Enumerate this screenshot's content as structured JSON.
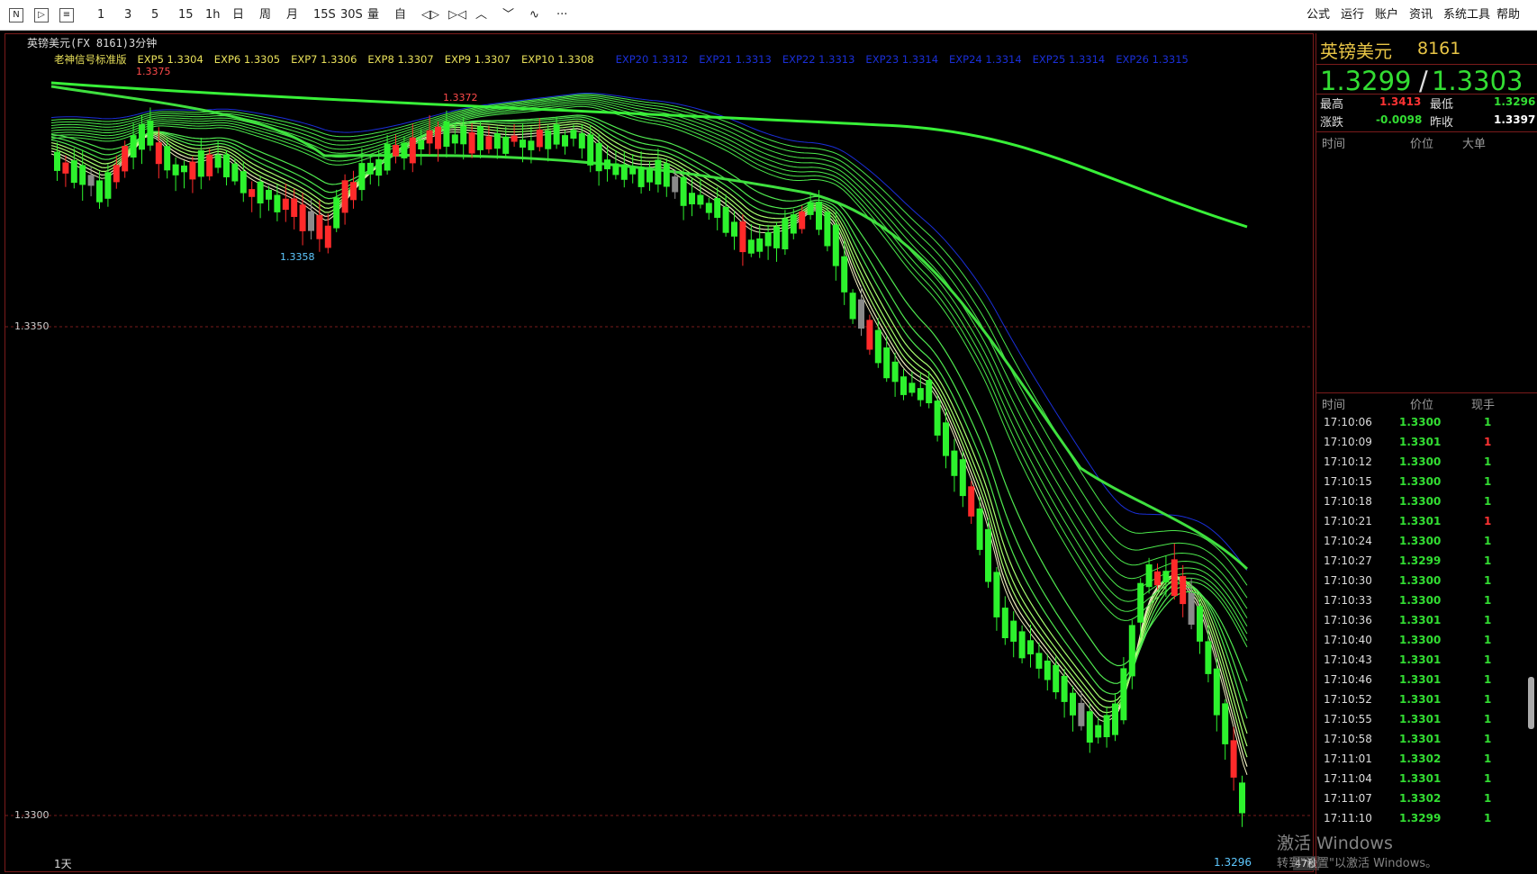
{
  "toolbar": {
    "boxed_buttons": [
      {
        "label": "N",
        "name": "new-button"
      },
      {
        "label": "▷",
        "name": "play-button"
      },
      {
        "label": "≡",
        "name": "doc-button"
      }
    ],
    "periods": [
      "1",
      "3",
      "5",
      "15",
      "1h",
      "日",
      "周",
      "月",
      "15S",
      "30S"
    ],
    "tools": [
      {
        "label": "量",
        "name": "volume-button"
      },
      {
        "label": "自",
        "name": "custom-button"
      },
      {
        "label": "◁▷",
        "name": "zoom-in-icon"
      },
      {
        "label": "▷◁",
        "name": "zoom-out-icon"
      },
      {
        "label": "︿",
        "name": "chevron-up-icon"
      },
      {
        "label": "﹀",
        "name": "chevron-down-icon"
      },
      {
        "label": "∿",
        "name": "wave-icon"
      },
      {
        "label": "···",
        "name": "more-icon"
      }
    ],
    "menu": [
      "公式",
      "运行",
      "账户",
      "资讯",
      "系统工具",
      "帮助"
    ]
  },
  "chart": {
    "title": "英镑美元(FX 8161)3分钟",
    "indicator_name": "老神信号标准版",
    "indicators_yellow": [
      "EXP5 1.3304",
      "EXP6 1.3305",
      "EXP7 1.3306",
      "EXP8 1.3307",
      "EXP9 1.3307",
      "EXP10 1.3308"
    ],
    "indicators_blue": [
      "EXP20 1.3312",
      "EXP21 1.3313",
      "EXP22 1.3313",
      "EXP23 1.3314",
      "EXP24 1.3314",
      "EXP25 1.3314",
      "EXP26 1.3315"
    ],
    "colors": {
      "yellow": "#e8e05a",
      "blue": "#1a2fd8",
      "up": "#ff2a2a",
      "down": "#2df22d",
      "gray": "#8a8a8a",
      "slow_ema": "#38f038"
    },
    "y_labels": [
      "1.3350",
      "1.3300"
    ],
    "annotations": {
      "high1": "1.3375",
      "high2": "1.3372",
      "low1": "1.3358",
      "low_last": "1.3296"
    },
    "bottom_left": "1天",
    "bottom_tag": "47秒"
  },
  "chart_data": {
    "type": "candlestick",
    "symbol": "英镑美元(FX 8161)",
    "interval": "3分钟",
    "y_ticks": [
      1.335,
      1.33
    ],
    "labelled_points": [
      {
        "label": "1.3375",
        "kind": "high"
      },
      {
        "label": "1.3372",
        "kind": "high"
      },
      {
        "label": "1.3358",
        "kind": "low"
      },
      {
        "label": "1.3296",
        "kind": "low"
      }
    ]
  },
  "panel": {
    "name": "英镑美元",
    "code": "8161",
    "bid": "1.3299",
    "ask": "1.3303",
    "stats": {
      "high_label": "最高",
      "high": "1.3413",
      "low_label": "最低",
      "low": "1.3296",
      "change_label": "涨跌",
      "change": "-0.0098",
      "prev_label": "昨收",
      "prev": "1.3397"
    },
    "big_headers": [
      "时间",
      "价位",
      "大单"
    ],
    "tick_headers": [
      "时间",
      "价位",
      "现手"
    ],
    "ticks": [
      {
        "t": "17:10:06",
        "p": "1.3300",
        "v": "1",
        "c": "#33dd33"
      },
      {
        "t": "17:10:09",
        "p": "1.3301",
        "v": "1",
        "c": "#ff3333"
      },
      {
        "t": "17:10:12",
        "p": "1.3300",
        "v": "1",
        "c": "#33dd33"
      },
      {
        "t": "17:10:15",
        "p": "1.3300",
        "v": "1",
        "c": "#33dd33"
      },
      {
        "t": "17:10:18",
        "p": "1.3300",
        "v": "1",
        "c": "#33dd33"
      },
      {
        "t": "17:10:21",
        "p": "1.3301",
        "v": "1",
        "c": "#ff3333"
      },
      {
        "t": "17:10:24",
        "p": "1.3300",
        "v": "1",
        "c": "#33dd33"
      },
      {
        "t": "17:10:27",
        "p": "1.3299",
        "v": "1",
        "c": "#33dd33"
      },
      {
        "t": "17:10:30",
        "p": "1.3300",
        "v": "1",
        "c": "#33dd33"
      },
      {
        "t": "17:10:33",
        "p": "1.3300",
        "v": "1",
        "c": "#33dd33"
      },
      {
        "t": "17:10:36",
        "p": "1.3301",
        "v": "1",
        "c": "#33dd33"
      },
      {
        "t": "17:10:40",
        "p": "1.3300",
        "v": "1",
        "c": "#33dd33"
      },
      {
        "t": "17:10:43",
        "p": "1.3301",
        "v": "1",
        "c": "#33dd33"
      },
      {
        "t": "17:10:46",
        "p": "1.3301",
        "v": "1",
        "c": "#33dd33"
      },
      {
        "t": "17:10:52",
        "p": "1.3301",
        "v": "1",
        "c": "#33dd33"
      },
      {
        "t": "17:10:55",
        "p": "1.3301",
        "v": "1",
        "c": "#33dd33"
      },
      {
        "t": "17:10:58",
        "p": "1.3301",
        "v": "1",
        "c": "#33dd33"
      },
      {
        "t": "17:11:01",
        "p": "1.3302",
        "v": "1",
        "c": "#33dd33"
      },
      {
        "t": "17:11:04",
        "p": "1.3301",
        "v": "1",
        "c": "#33dd33"
      },
      {
        "t": "17:11:07",
        "p": "1.3302",
        "v": "1",
        "c": "#33dd33"
      },
      {
        "t": "17:11:10",
        "p": "1.3299",
        "v": "1",
        "c": "#33dd33"
      }
    ]
  },
  "watermark": {
    "line1": "激活 Windows",
    "line2": "转到\"设置\"以激活 Windows。"
  }
}
